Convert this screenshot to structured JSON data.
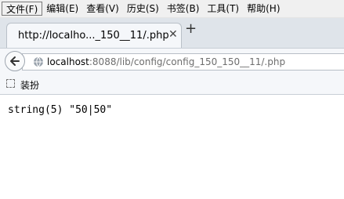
{
  "menubar": {
    "items": [
      "文件(F)",
      "编辑(E)",
      "查看(V)",
      "历史(S)",
      "书签(B)",
      "工具(T)",
      "帮助(H)"
    ]
  },
  "tab": {
    "title": "http://localho..._150__11/.php",
    "close_glyph": "✕"
  },
  "newtab": {
    "glyph": "+"
  },
  "navbar": {
    "url_host": "localhost",
    "url_path": ":8088/lib/config/config_150_150__11/.php"
  },
  "bookmarks": {
    "label": "装扮"
  },
  "content": {
    "text": "string(5) \"50|50\""
  },
  "colors": {
    "menubar_bg": "#f0f0f0",
    "toolbar_bg": "#f5f7fa",
    "tabstrip_bg": "#dfe4ea",
    "url_path": "#6e6e6e"
  }
}
